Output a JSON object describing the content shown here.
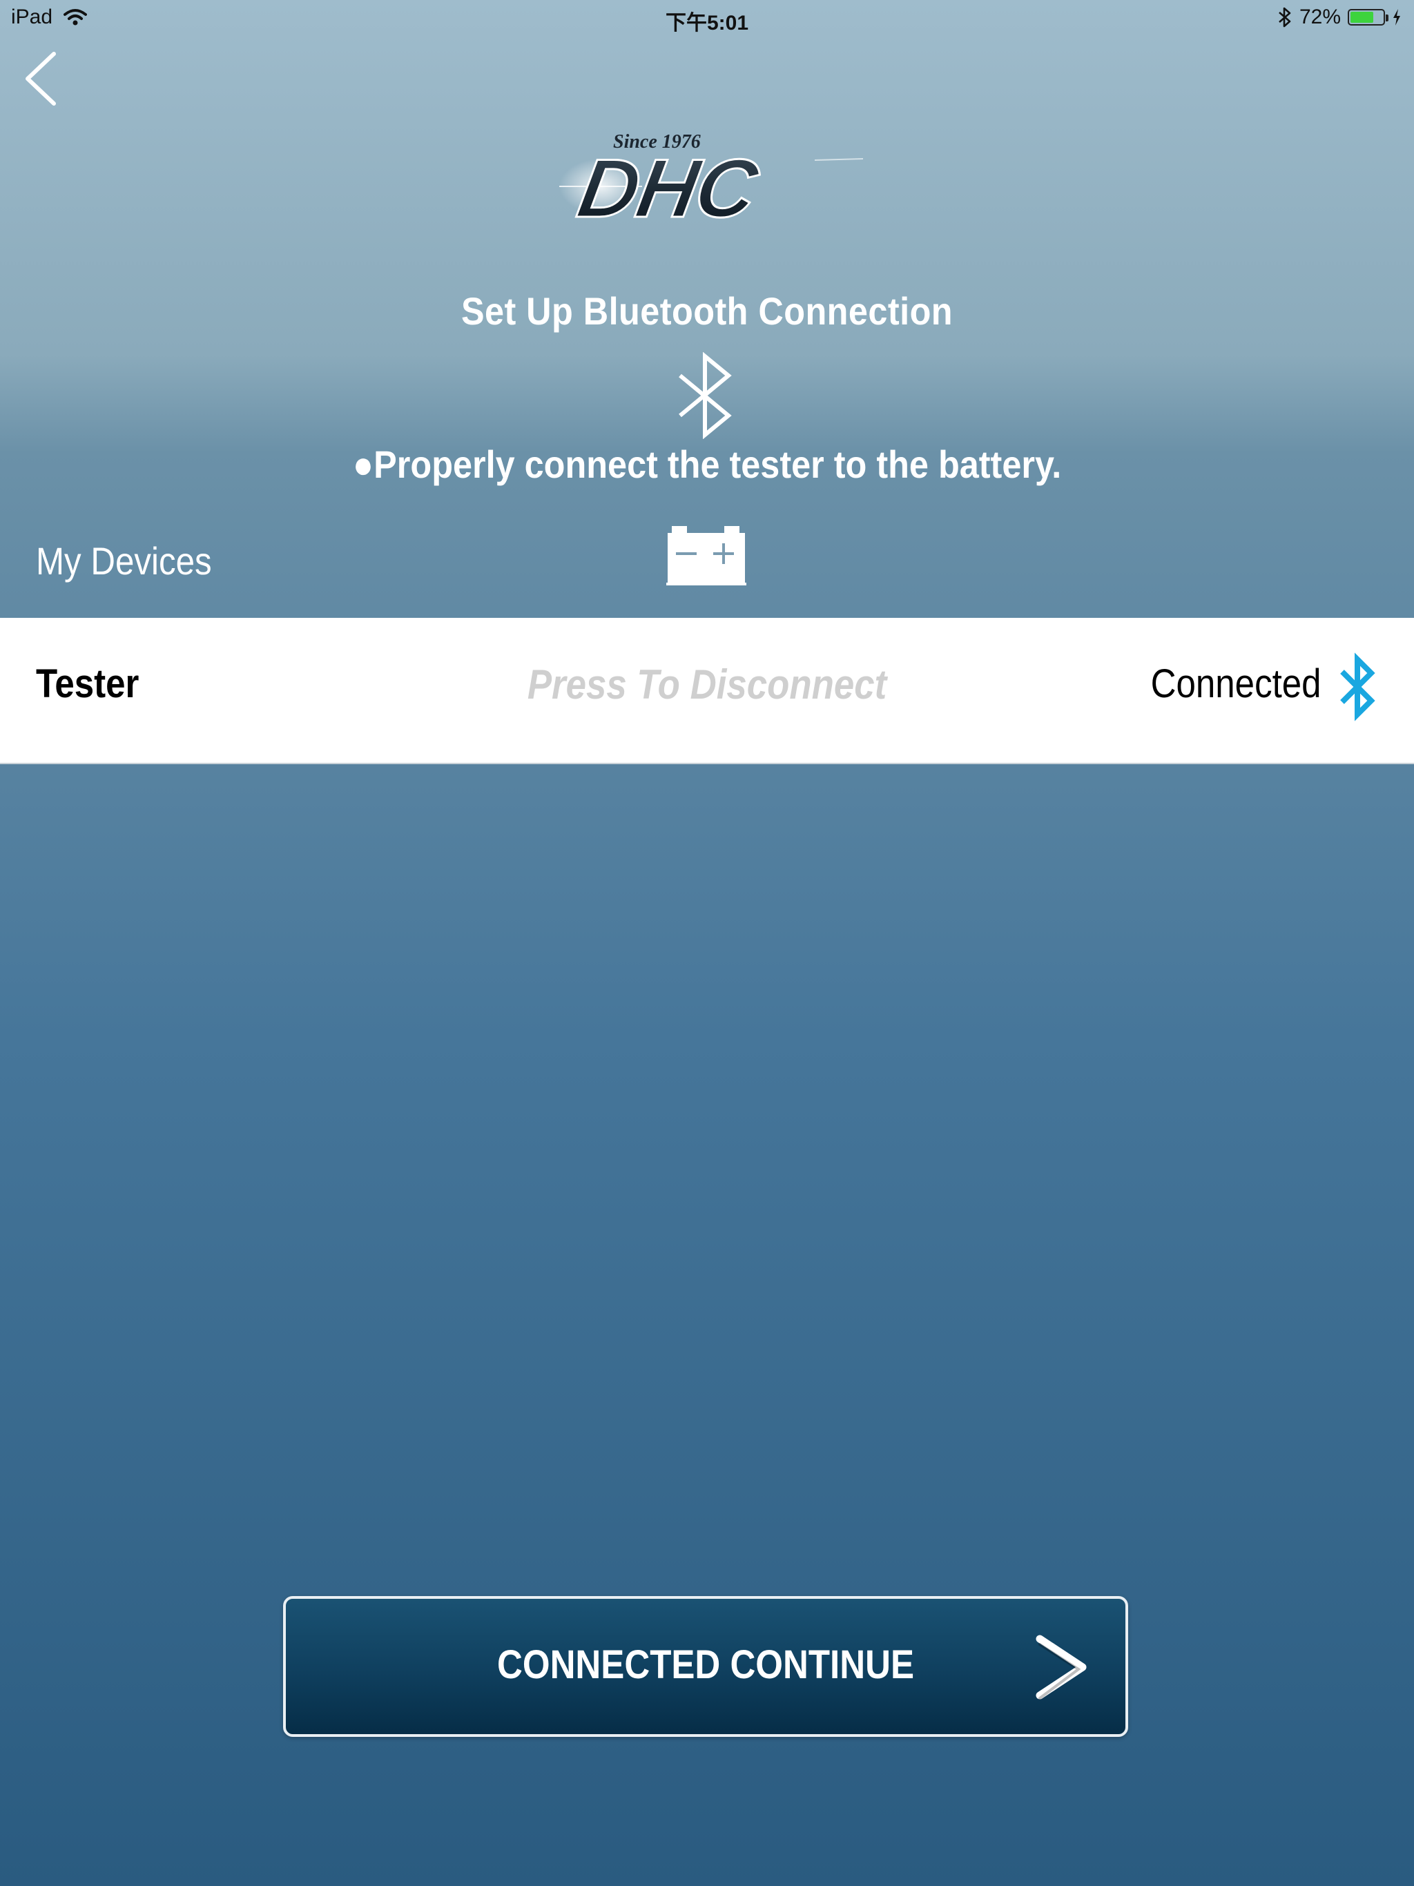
{
  "status_bar": {
    "device": "iPad",
    "time": "下午5:01",
    "battery_percent": "72%",
    "battery_level": 0.72,
    "icons": [
      "wifi-icon",
      "bluetooth-icon",
      "battery-icon",
      "charging-icon"
    ]
  },
  "header": {
    "back_icon": "chevron-left-icon",
    "logo_text": "DHC",
    "logo_tagline": "Since 1976"
  },
  "setup": {
    "title": "Set Up Bluetooth Connection",
    "instruction": "●Properly connect the tester to the battery."
  },
  "devices": {
    "section_label": "My Devices",
    "items": [
      {
        "name": "Tester",
        "hint": "Press To Disconnect",
        "status": "Connected"
      }
    ]
  },
  "footer": {
    "continue_label": "CONNECTED CONTINUE"
  },
  "colors": {
    "bluetooth_accent": "#1aa7e0",
    "button_dark": "#0f3f5e",
    "hint_gray": "#cfcfcf"
  }
}
